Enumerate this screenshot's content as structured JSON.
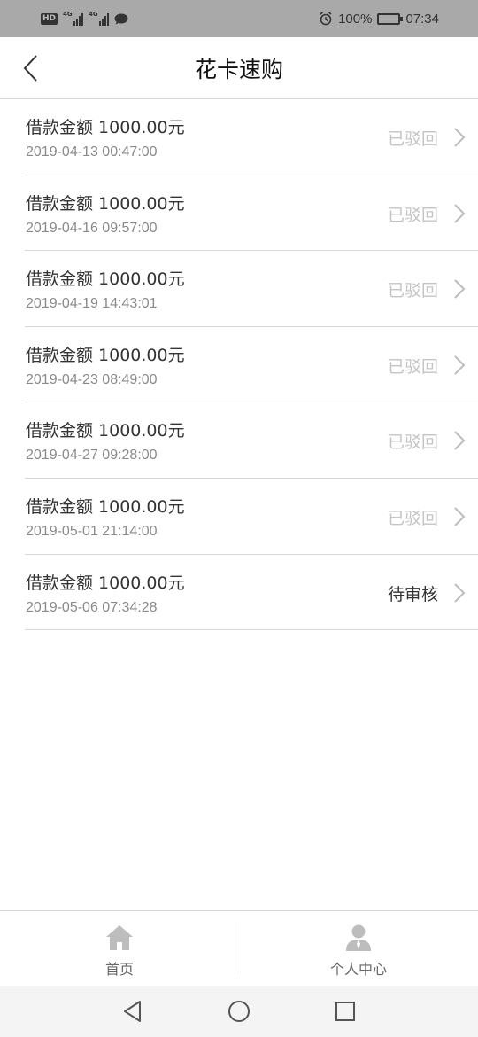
{
  "status_bar": {
    "hd_label": "HD",
    "network_1": "4G",
    "network_2": "4G",
    "battery_percent": "100%",
    "time": "07:34"
  },
  "header": {
    "title": "花卡速购"
  },
  "loans": [
    {
      "amount": "借款金额 1000.00元",
      "date": "2019-04-13 00:47:00",
      "status": "已驳回",
      "status_type": "rejected"
    },
    {
      "amount": "借款金额 1000.00元",
      "date": "2019-04-16 09:57:00",
      "status": "已驳回",
      "status_type": "rejected"
    },
    {
      "amount": "借款金额 1000.00元",
      "date": "2019-04-19 14:43:01",
      "status": "已驳回",
      "status_type": "rejected"
    },
    {
      "amount": "借款金额 1000.00元",
      "date": "2019-04-23 08:49:00",
      "status": "已驳回",
      "status_type": "rejected"
    },
    {
      "amount": "借款金额 1000.00元",
      "date": "2019-04-27 09:28:00",
      "status": "已驳回",
      "status_type": "rejected"
    },
    {
      "amount": "借款金额 1000.00元",
      "date": "2019-05-01 21:14:00",
      "status": "已驳回",
      "status_type": "rejected"
    },
    {
      "amount": "借款金额 1000.00元",
      "date": "2019-05-06 07:34:28",
      "status": "待审核",
      "status_type": "pending"
    }
  ],
  "tab_bar": {
    "home_label": "首页",
    "home_icon": "house-icon",
    "profile_label": "个人中心",
    "profile_icon": "user-icon"
  },
  "colors": {
    "rejected_text": "#c4c4c4",
    "pending_text": "#333333",
    "status_bar_bg": "#a9a9a9"
  }
}
